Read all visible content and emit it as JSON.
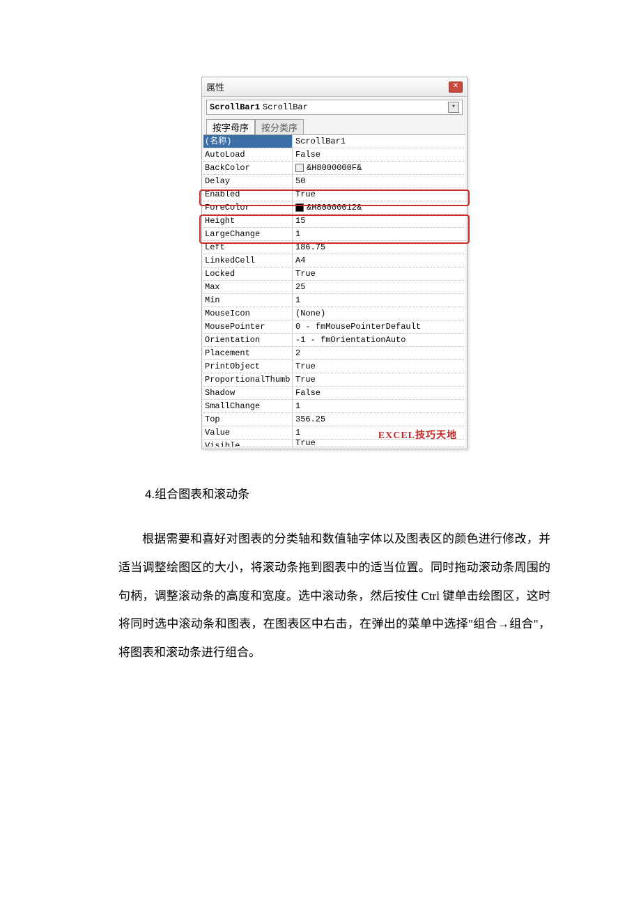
{
  "propWindow": {
    "title": "属性",
    "objectBold": "ScrollBar1",
    "objectType": "ScrollBar",
    "tabs": {
      "sort_alpha": "按字母序",
      "sort_cat": "按分类序"
    },
    "rows": [
      {
        "name": "(名称)",
        "value": "ScrollBar1",
        "selected": true
      },
      {
        "name": "AutoLoad",
        "value": "False"
      },
      {
        "name": "BackColor",
        "value": "&H8000000F&",
        "swatch": "#eeeeee"
      },
      {
        "name": "Delay",
        "value": "50"
      },
      {
        "name": "Enabled",
        "value": "True"
      },
      {
        "name": "ForeColor",
        "value": "&H80000012&",
        "swatch": "#000000"
      },
      {
        "name": "Height",
        "value": "15"
      },
      {
        "name": "LargeChange",
        "value": "1"
      },
      {
        "name": "Left",
        "value": "186.75"
      },
      {
        "name": "LinkedCell",
        "value": "A4"
      },
      {
        "name": "Locked",
        "value": "True"
      },
      {
        "name": "Max",
        "value": "25"
      },
      {
        "name": "Min",
        "value": "1"
      },
      {
        "name": "MouseIcon",
        "value": "(None)"
      },
      {
        "name": "MousePointer",
        "value": "0 - fmMousePointerDefault"
      },
      {
        "name": "Orientation",
        "value": "-1 - fmOrientationAuto"
      },
      {
        "name": "Placement",
        "value": "2"
      },
      {
        "name": "PrintObject",
        "value": "True"
      },
      {
        "name": "ProportionalThumb",
        "value": "True"
      },
      {
        "name": "Shadow",
        "value": "False"
      },
      {
        "name": "SmallChange",
        "value": "1"
      },
      {
        "name": "Top",
        "value": "356.25"
      },
      {
        "name": "Value",
        "value": "1"
      },
      {
        "name": "Visible",
        "value": "True",
        "cut": true
      }
    ],
    "watermark": "EXCEL技巧天地"
  },
  "section": {
    "heading": "4.组合图表和滚动条",
    "paragraph": "根据需要和喜好对图表的分类轴和数值轴字体以及图表区的颜色进行修改，并适当调整绘图区的大小，将滚动条拖到图表中的适当位置。同时拖动滚动条周围的句柄，调整滚动条的高度和宽度。选中滚动条，然后按住 Ctrl 键单击绘图区，这时将同时选中滚动条和图表，在图表区中右击，在弹出的菜单中选择\"组合→组合\"，将图表和滚动条进行组合。"
  }
}
